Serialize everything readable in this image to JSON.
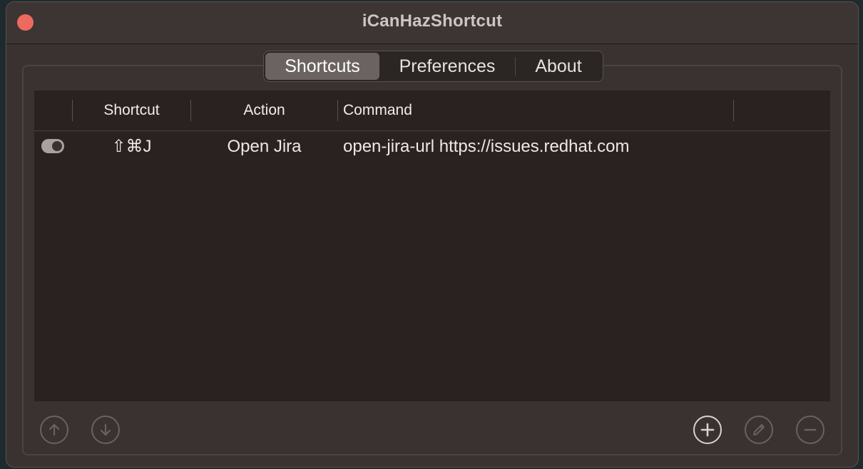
{
  "window": {
    "title": "iCanHazShortcut"
  },
  "tabs": [
    {
      "label": "Shortcuts",
      "selected": true
    },
    {
      "label": "Preferences",
      "selected": false
    },
    {
      "label": "About",
      "selected": false
    }
  ],
  "table": {
    "columns": [
      "",
      "Shortcut",
      "Action",
      "Command"
    ],
    "rows": [
      {
        "enabled": true,
        "shortcut": "⇧⌘J",
        "action": "Open Jira",
        "command": "open-jira-url https://issues.redhat.com"
      }
    ]
  },
  "toolbar": {
    "left_buttons": [
      "arrow-up-icon",
      "arrow-down-icon"
    ],
    "right_buttons": [
      "plus-icon",
      "pencil-icon",
      "minus-icon"
    ]
  },
  "colors": {
    "close": "#ee6a5e",
    "window_bg": "#3a3230",
    "table_bg": "#2a2221"
  }
}
